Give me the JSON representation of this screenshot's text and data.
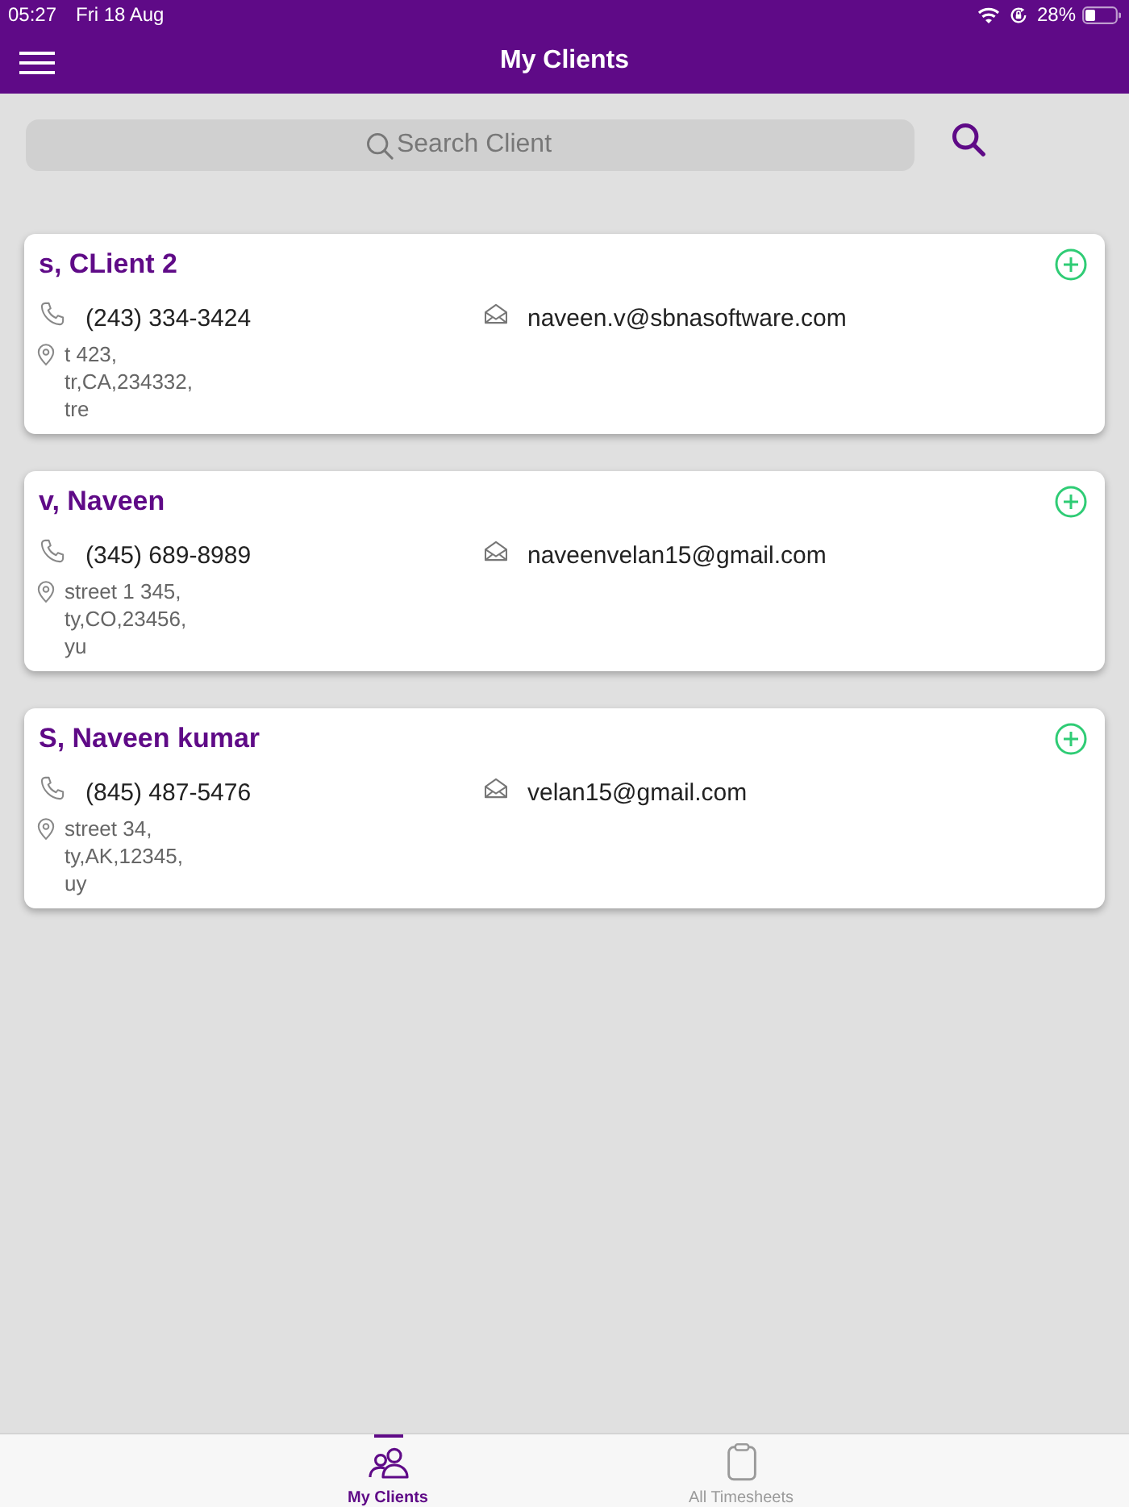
{
  "status_bar": {
    "time": "05:27",
    "date": "Fri 18 Aug",
    "battery": "28%"
  },
  "nav_bar": {
    "title": "My Clients"
  },
  "search": {
    "placeholder": "Search Client"
  },
  "clients": [
    {
      "name": "s, CLient 2",
      "phone": "(243) 334-3424",
      "email": "naveen.v@sbnasoftware.com",
      "address": [
        "t 423,",
        "tr,CA,234332,",
        "tre"
      ]
    },
    {
      "name": "v, Naveen",
      "phone": "(345) 689-8989",
      "email": "naveenvelan15@gmail.com",
      "address": [
        "street 1 345,",
        "ty,CO,23456,",
        "yu"
      ]
    },
    {
      "name": "S, Naveen kumar",
      "phone": "(845) 487-5476",
      "email": "velan15@gmail.com",
      "address": [
        "street 34,",
        "ty,AK,12345,",
        "uy"
      ]
    }
  ],
  "tab_bar": [
    {
      "label": "My Clients",
      "selected": true
    },
    {
      "label": "All Timesheets",
      "selected": false
    }
  ]
}
